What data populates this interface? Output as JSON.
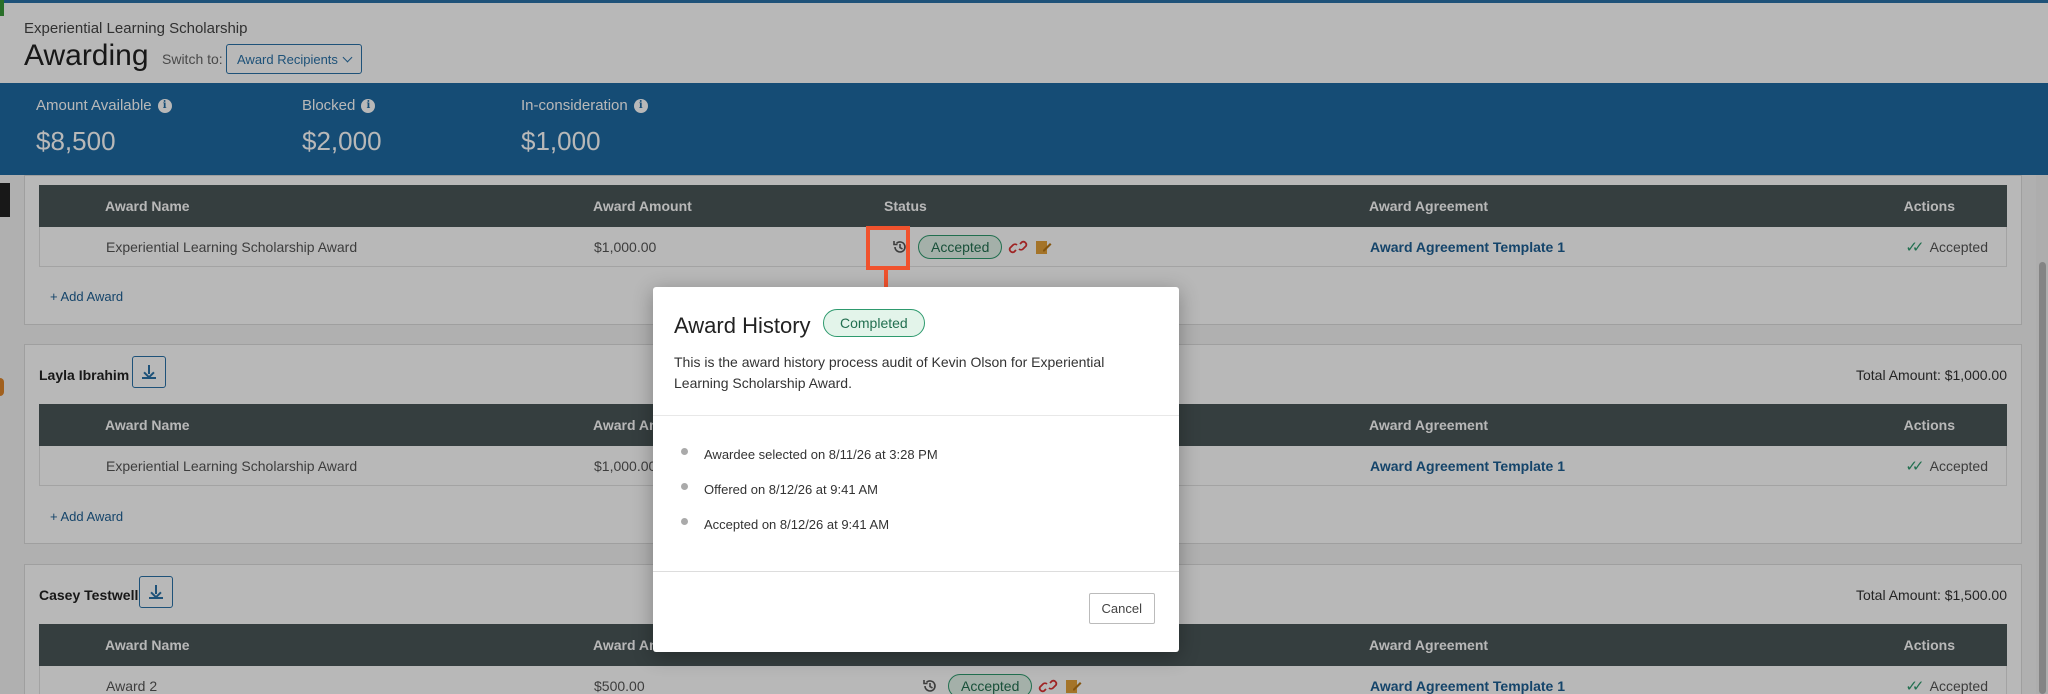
{
  "header": {
    "breadcrumb": "Experiential Learning Scholarship",
    "title": "Awarding",
    "switch_label": "Switch to:",
    "switch_value": "Award Recipients"
  },
  "stats": [
    {
      "label": "Amount Available",
      "value": "$8,500"
    },
    {
      "label": "Blocked",
      "value": "$2,000"
    },
    {
      "label": "In-consideration",
      "value": "$1,000"
    }
  ],
  "columns": {
    "name": "Award Name",
    "amount": "Award Amount",
    "status": "Status",
    "agreement": "Award Agreement",
    "actions": "Actions"
  },
  "cards": [
    {
      "row": {
        "name": "Experiential Learning Scholarship Award",
        "amount": "$1,000.00",
        "status": "Accepted",
        "agreement": "Award Agreement Template 1",
        "action": "Accepted"
      },
      "add_award": "Add Award"
    },
    {
      "recipient": "Layla Ibrahim",
      "total": "Total Amount: $1,000.00",
      "row": {
        "name": "Experiential Learning Scholarship Award",
        "amount": "$1,000.00",
        "agreement": "Award Agreement Template 1",
        "action": "Accepted"
      },
      "add_award": "Add Award"
    },
    {
      "recipient": "Casey Testwell",
      "total": "Total Amount: $1,500.00",
      "row": {
        "name": "Award 2",
        "amount": "$500.00",
        "status": "Accepted",
        "agreement": "Award Agreement Template 1",
        "action": "Accepted"
      }
    }
  ],
  "modal": {
    "title": "Award History",
    "badge": "Completed",
    "description": "This is the award history process audit of Kevin Olson for Experiential Learning Scholarship Award.",
    "events": [
      "Awardee selected on 8/11/26 at 3:28 PM",
      "Offered on 8/12/26 at 9:41 AM",
      "Accepted on 8/12/26 at 9:41 AM"
    ],
    "cancel": "Cancel"
  },
  "colors": {
    "brand_blue": "#1e6aa3",
    "table_header": "#4a5658",
    "accepted_green": "#2e9a6e",
    "highlight_orange": "#f0522d"
  }
}
